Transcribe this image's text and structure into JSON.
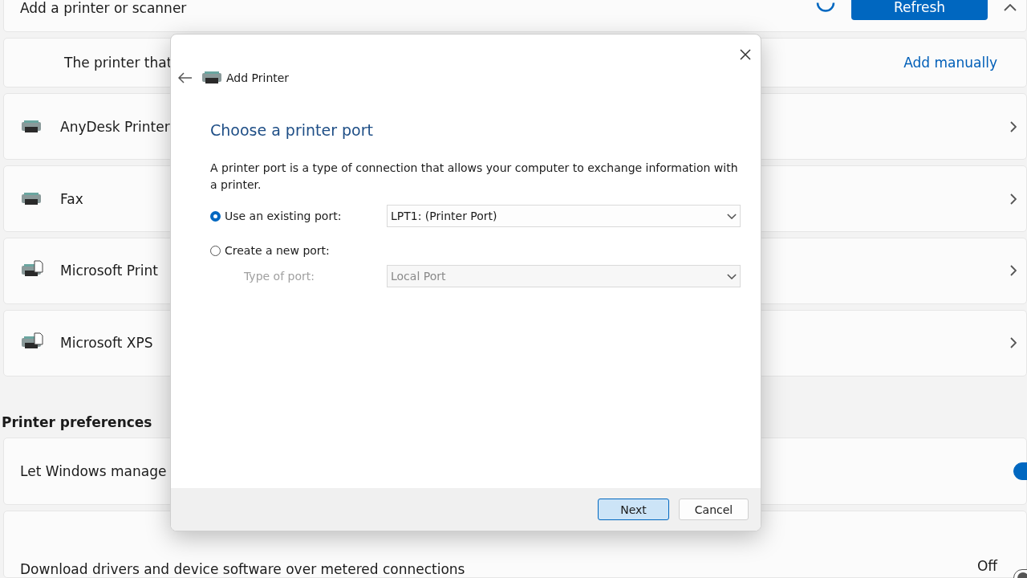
{
  "settings": {
    "add_section": {
      "title": "Add a printer or scanner",
      "refresh_button": "Refresh",
      "expanded": true,
      "hint": "The printer that",
      "add_manually": "Add manually"
    },
    "printers": [
      {
        "name": "AnyDesk Printer",
        "kind": "printer"
      },
      {
        "name": "Fax",
        "kind": "printer"
      },
      {
        "name": "Microsoft Print",
        "kind": "document"
      },
      {
        "name": "Microsoft XPS",
        "kind": "document"
      }
    ],
    "preferences_heading": "Printer preferences",
    "preferences": [
      {
        "label": "Let Windows manage",
        "on": true
      },
      {
        "label": "Download drivers and device software over metered connections",
        "state_label": "Off",
        "on": false
      }
    ]
  },
  "dialog": {
    "title": "Add Printer",
    "heading": "Choose a printer port",
    "description": "A printer port is a type of connection that allows your computer to exchange information with a printer.",
    "options": [
      {
        "label": "Use an existing port:",
        "selected": true,
        "value": "LPT1: (Printer Port)"
      },
      {
        "label": "Create a new port:",
        "selected": false,
        "sub_label": "Type of port:",
        "value": "Local Port"
      }
    ],
    "buttons": [
      {
        "label": "Next",
        "kind": "primary"
      },
      {
        "label": "Cancel",
        "kind": "secondary"
      }
    ]
  }
}
